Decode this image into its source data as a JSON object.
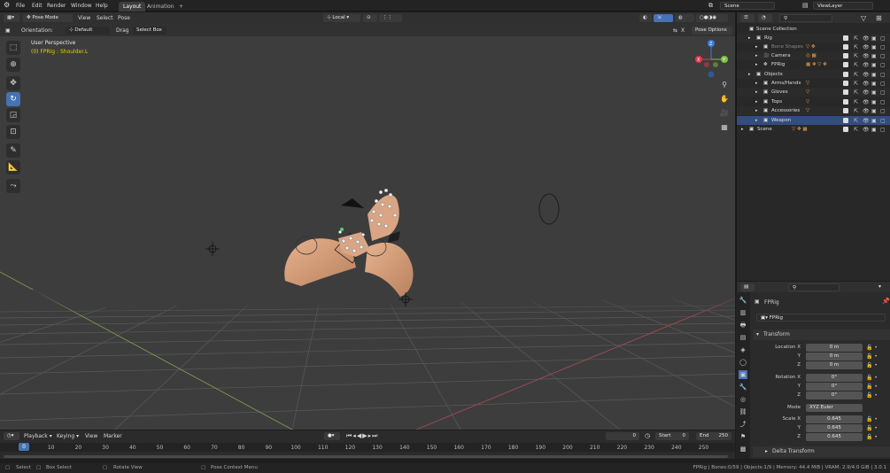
{
  "menu": {
    "file": "File",
    "edit": "Edit",
    "render": "Render",
    "window": "Window",
    "help": "Help"
  },
  "workspaces": [
    "Layout",
    "Animation",
    "+"
  ],
  "scene": {
    "name": "Scene",
    "view_layer": "ViewLayer"
  },
  "viewport_header": {
    "mode": "Pose Mode",
    "view": "View",
    "select": "Select",
    "pose": "Pose",
    "transform_orientation": "Local"
  },
  "tool_settings": {
    "orientation_label": "Orientation:",
    "orientation_value": "Default",
    "drag_label": "Drag",
    "drag_value": "Select Box",
    "pose_options": "Pose Options",
    "x_toggle": "X"
  },
  "viewport": {
    "perspective": "User Perspective",
    "active_object": "(0) FPRig : Shoulder.L"
  },
  "gizmo_axes": {
    "z": "Z",
    "y": "Y",
    "x": "X"
  },
  "outliner": {
    "root": "Scene Collection",
    "rows": [
      {
        "label": "Rig"
      },
      {
        "label": "Bone Shapes"
      },
      {
        "label": "Camera"
      },
      {
        "label": "FPRig"
      },
      {
        "label": "Objects"
      },
      {
        "label": "Arms/Hands"
      },
      {
        "label": "Gloves"
      },
      {
        "label": "Tops"
      },
      {
        "label": "Accessories"
      },
      {
        "label": "Weapon"
      },
      {
        "label": "Scene"
      }
    ]
  },
  "properties": {
    "object_name": "FPRig",
    "data_name": "FPRig",
    "panel_transform": "Transform",
    "location_label": "Location X",
    "location_x": "0 m",
    "location_y": "0 m",
    "location_z": "0 m",
    "rotation_label": "Rotation X",
    "rotation_x": "0°",
    "rotation_y": "0°",
    "rotation_z": "0°",
    "mode_label": "Mode",
    "mode_value": "XYZ Euler",
    "scale_label": "Scale X",
    "scale_x": "0.645",
    "scale_y": "0.645",
    "scale_z": "0.645",
    "y_label": "Y",
    "z_label": "Z",
    "delta_transform": "Delta Transform"
  },
  "timeline": {
    "playback": "Playback",
    "keying": "Keying",
    "view": "View",
    "marker": "Marker",
    "current_frame": "0",
    "start_label": "Start",
    "start": "0",
    "end_label": "End",
    "end": "250",
    "ruler": [
      "0",
      "10",
      "20",
      "30",
      "40",
      "50",
      "60",
      "70",
      "80",
      "90",
      "100",
      "110",
      "120",
      "130",
      "140",
      "150",
      "160",
      "170",
      "180",
      "190",
      "200",
      "210",
      "220",
      "230",
      "240",
      "250"
    ]
  },
  "status": {
    "select": "Select",
    "box_select": "Box Select",
    "rotate_view": "Rotate View",
    "context_menu": "Pose Context Menu",
    "info": "FPRig | Bones:0/59 | Objects:1/9 | Memory: 44.4 MiB | VRAM: 2.9/4.0 GiB | 3.0.1"
  },
  "colors": {
    "accent": "#4772b3",
    "selection": "#334d80",
    "active_text": "#e5d200",
    "axis_x": "#e0394d",
    "axis_y": "#7ec341",
    "axis_z": "#3b7dd8"
  },
  "icons": [
    "blender-logo-icon",
    "select-box-icon",
    "cursor-icon",
    "move-icon",
    "rotate-icon",
    "scale-icon",
    "transform-icon",
    "annotate-icon",
    "measure-icon",
    "zoom-icon",
    "hand-icon",
    "camera-icon",
    "grid-icon",
    "eye-icon",
    "camera-render-icon",
    "monitor-icon"
  ]
}
